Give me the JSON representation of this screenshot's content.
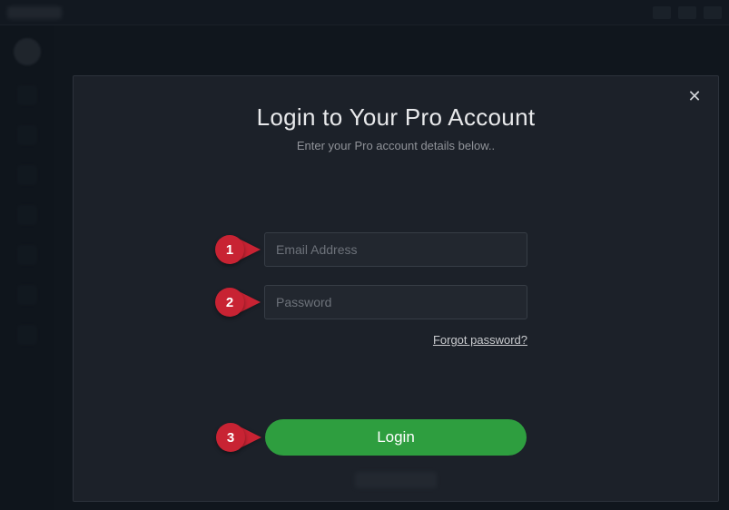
{
  "modal": {
    "title": "Login to Your Pro Account",
    "subtitle": "Enter your Pro account details below..",
    "email_placeholder": "Email Address",
    "password_placeholder": "Password",
    "forgot_label": "Forgot password?",
    "login_label": "Login",
    "close_glyph": "✕"
  },
  "callouts": {
    "one": "1",
    "two": "2",
    "three": "3"
  }
}
